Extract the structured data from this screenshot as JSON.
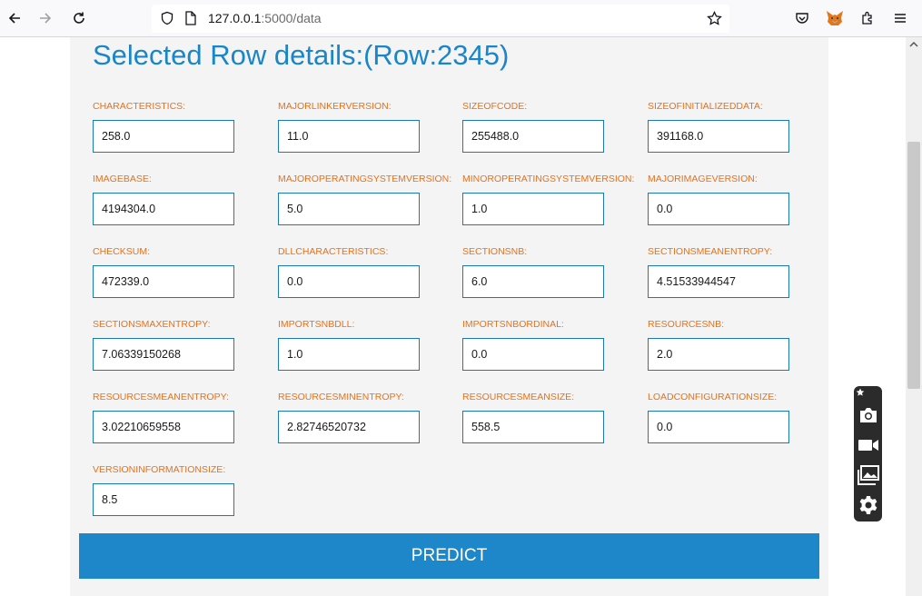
{
  "browser": {
    "url_host": "127.0.0.1",
    "url_rest": ":5000/data"
  },
  "page": {
    "title": "Selected Row details:(Row:2345)",
    "fields": [
      {
        "label": "CHARACTERISTICS:",
        "value": "258.0"
      },
      {
        "label": "MAJORLINKERVERSION:",
        "value": "11.0"
      },
      {
        "label": "SIZEOFCODE:",
        "value": "255488.0"
      },
      {
        "label": "SIZEOFINITIALIZEDDATA:",
        "value": "391168.0"
      },
      {
        "label": "IMAGEBASE:",
        "value": "4194304.0"
      },
      {
        "label": "MAJOROPERATINGSYSTEMVERSION:",
        "value": "5.0"
      },
      {
        "label": "MINOROPERATINGSYSTEMVERSION:",
        "value": "1.0"
      },
      {
        "label": "MAJORIMAGEVERSION:",
        "value": "0.0"
      },
      {
        "label": "CHECKSUM:",
        "value": "472339.0"
      },
      {
        "label": "DLLCHARACTERISTICS:",
        "value": "0.0"
      },
      {
        "label": "SECTIONSNB:",
        "value": "6.0"
      },
      {
        "label": "SECTIONSMEANENTROPY:",
        "value": "4.51533944547"
      },
      {
        "label": "SECTIONSMAXENTROPY:",
        "value": "7.06339150268"
      },
      {
        "label": "IMPORTSNBDLL:",
        "value": "1.0"
      },
      {
        "label": "IMPORTSNBORDINAL:",
        "value": "0.0"
      },
      {
        "label": "RESOURCESNB:",
        "value": "2.0"
      },
      {
        "label": "RESOURCESMEANENTROPY:",
        "value": "3.02210659558"
      },
      {
        "label": "RESOURCESMINENTROPY:",
        "value": "2.82746520732"
      },
      {
        "label": "RESOURCESMEANSIZE:",
        "value": "558.5"
      },
      {
        "label": "LOADCONFIGURATIONSIZE:",
        "value": "0.0"
      },
      {
        "label": "VERSIONINFORMATIONSIZE:",
        "value": "8.5"
      }
    ],
    "predict_label": "PREDICT"
  },
  "colors": {
    "title": "#1a85c8",
    "label": "#e8711a",
    "button": "#1e87ca",
    "panel": "#f4f4f4"
  }
}
